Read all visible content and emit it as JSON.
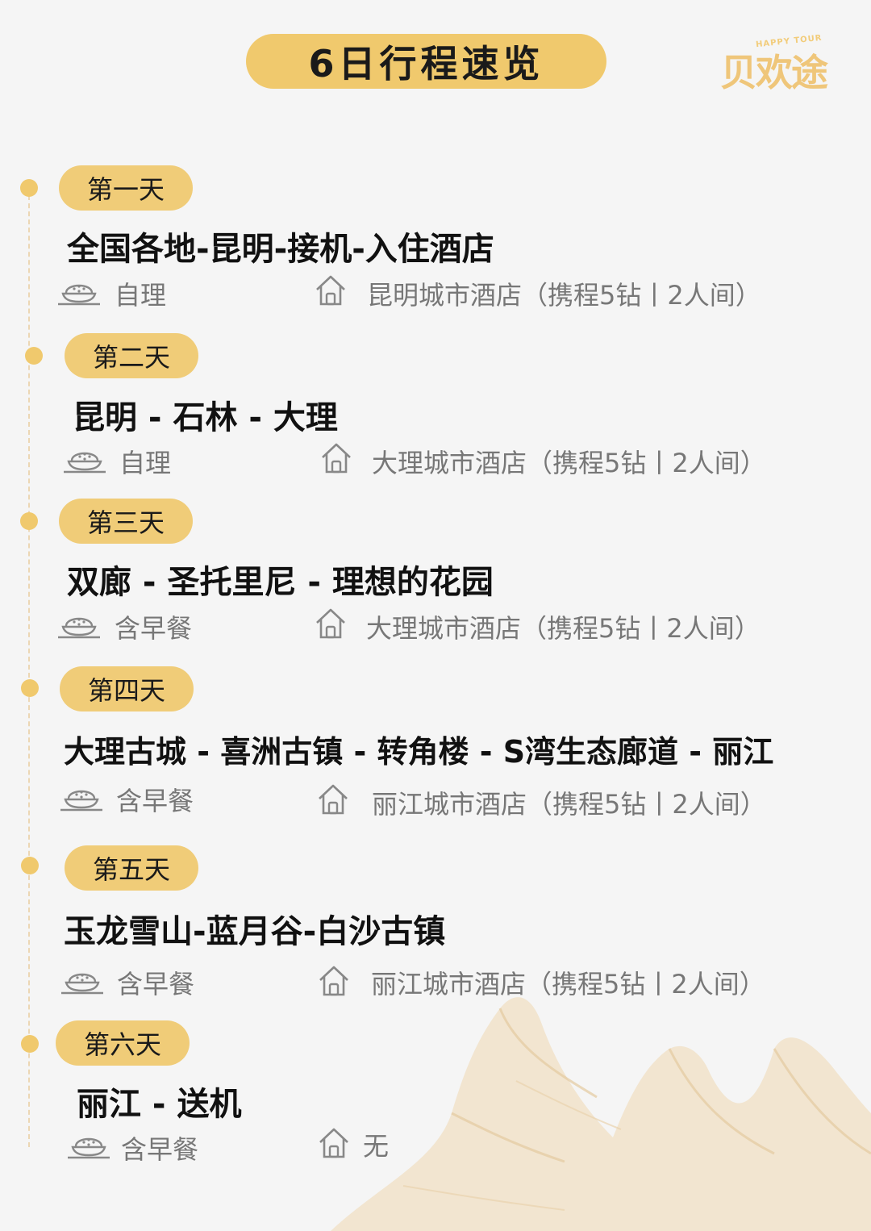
{
  "title": "6日行程速览",
  "logo": {
    "tagline": "HAPPY TOUR",
    "brand": "贝欢途"
  },
  "days": [
    {
      "label": "第一天",
      "route": "全国各地-昆明-接机-入住酒店",
      "meal": "自理",
      "hotel": "昆明城市酒店（携程5钻丨2人间）"
    },
    {
      "label": "第二天",
      "route": "昆明 - 石林 - 大理",
      "meal": "自理",
      "hotel": "大理城市酒店（携程5钻丨2人间）"
    },
    {
      "label": "第三天",
      "route": "双廊 - 圣托里尼 - 理想的花园",
      "meal": "含早餐",
      "hotel": "大理城市酒店（携程5钻丨2人间）"
    },
    {
      "label": "第四天",
      "route": "大理古城 - 喜洲古镇 - 转角楼 - S湾生态廊道 - 丽江",
      "meal": "含早餐",
      "hotel": "丽江城市酒店（携程5钻丨2人间）"
    },
    {
      "label": "第五天",
      "route": "玉龙雪山-蓝月谷-白沙古镇",
      "meal": "含早餐",
      "hotel": "丽江城市酒店（携程5钻丨2人间）"
    },
    {
      "label": "第六天",
      "route": "丽江 - 送机",
      "meal": "含早餐",
      "hotel": "无"
    }
  ],
  "colors": {
    "accent": "#f0c96d",
    "pill": "#f0cc78",
    "muted_text": "#777777",
    "background": "#f5f5f5"
  },
  "icons": {
    "meal": "rice-bowl-icon",
    "hotel": "house-icon"
  }
}
